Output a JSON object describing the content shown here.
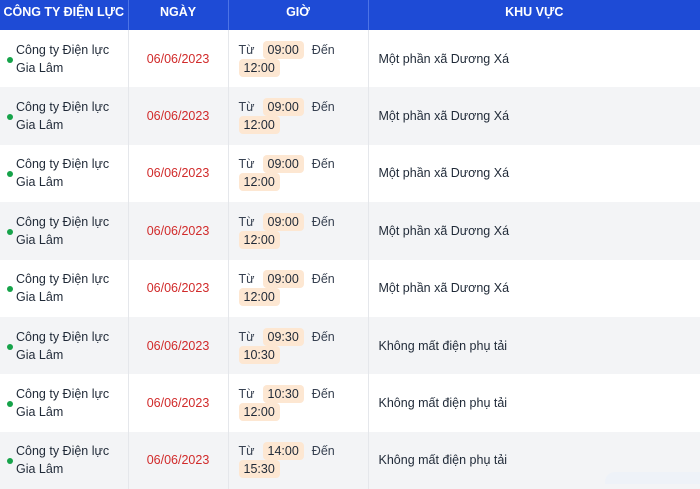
{
  "header": {
    "company": "CÔNG TY ĐIỆN LỰC",
    "date": "NGÀY",
    "time": "GIỜ",
    "area": "KHU VỰC"
  },
  "labels": {
    "from": "Từ",
    "to": "Đến"
  },
  "rows": [
    {
      "company": "Công ty Điện lực Gia Lâm",
      "date": "06/06/2023",
      "start": "09:00",
      "end": "12:00",
      "area": "Một phần xã Dương Xá"
    },
    {
      "company": "Công ty Điện lực Gia Lâm",
      "date": "06/06/2023",
      "start": "09:00",
      "end": "12:00",
      "area": "Một phần xã Dương Xá"
    },
    {
      "company": "Công ty Điện lực Gia Lâm",
      "date": "06/06/2023",
      "start": "09:00",
      "end": "12:00",
      "area": "Một phần xã Dương Xá"
    },
    {
      "company": "Công ty Điện lực Gia Lâm",
      "date": "06/06/2023",
      "start": "09:00",
      "end": "12:00",
      "area": "Một phần xã Dương Xá"
    },
    {
      "company": "Công ty Điện lực Gia Lâm",
      "date": "06/06/2023",
      "start": "09:00",
      "end": "12:00",
      "area": "Một phần xã Dương Xá"
    },
    {
      "company": "Công ty Điện lực Gia Lâm",
      "date": "06/06/2023",
      "start": "09:30",
      "end": "10:30",
      "area": "Không mất điện phụ tải"
    },
    {
      "company": "Công ty Điện lực Gia Lâm",
      "date": "06/06/2023",
      "start": "10:30",
      "end": "12:00",
      "area": "Không mất điện phụ tải"
    },
    {
      "company": "Công ty Điện lực Gia Lâm",
      "date": "06/06/2023",
      "start": "14:00",
      "end": "15:30",
      "area": "Không mất điện phụ tải"
    }
  ],
  "colors": {
    "header_bg": "#1e4bd6",
    "date_text": "#d12b2b",
    "time_pill": "#fde7d2",
    "status_dot": "#16a34a",
    "row_alt": "#f3f4f6"
  }
}
